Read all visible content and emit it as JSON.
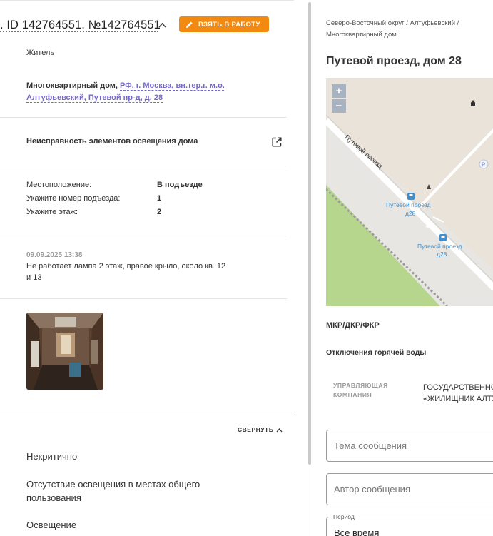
{
  "ticket": {
    "id_text": ". ID 142764551. №142764551",
    "take_button": "ВЗЯТЬ В РАБОТУ",
    "applicant_role": "Житель",
    "address_type": "Многоквартирный дом,",
    "address_link": "РФ, г. Москва, вн.тер.г. м.о. Алтуфьевский, Путевой пр-д, д. 28",
    "problem_title": "Неисправность элементов освещения дома",
    "details": [
      {
        "label": "Местоположение:",
        "value": "В подъезде"
      },
      {
        "label": "Укажите номер подъезда:",
        "value": "1"
      },
      {
        "label": "Укажите этаж:",
        "value": "2"
      }
    ],
    "comment_date": "09.09.2025 13:38",
    "comment_text": "Не работает лампа 2 этаж, правое крыло, около кв. 12 и 13",
    "collapse_label": "СВЕРНУТЬ",
    "categories": [
      "Некритично",
      "Отсутствие освещения в местах общего пользования",
      "Освещение"
    ]
  },
  "house": {
    "breadcrumb": "Северо-Восточный округ / Алтуфьевский / Многоквартирный дом",
    "title": "Путевой проезд, дом 28",
    "map": {
      "zoom_in": "+",
      "zoom_out": "−",
      "road_label": "Путевой проезд",
      "stop_label_1_line1": "Путевой проезд",
      "stop_label_1_line2": "д28",
      "stop_label_2_line1": "Путевой проезд",
      "stop_label_2_line2": "д28",
      "poi_letter": "P"
    },
    "program": "МКР/ДКР/ФКР",
    "hot_water": "Отключения горячей воды",
    "management_label": "УПРАВЛЯЮЩАЯ КОМПАНИЯ",
    "management_line1": "ГОСУДАРСТВЕННО",
    "management_line2": "«ЖИЛИЩНИК АЛТУ"
  },
  "form": {
    "subject_placeholder": "Тема сообщения",
    "author_placeholder": "Автор сообщения",
    "period_label": "Период",
    "period_value": "Все время"
  },
  "colors": {
    "accent_orange": "#f28a12",
    "link_purple": "#7569c8",
    "transit_blue": "#3d8fcf"
  }
}
